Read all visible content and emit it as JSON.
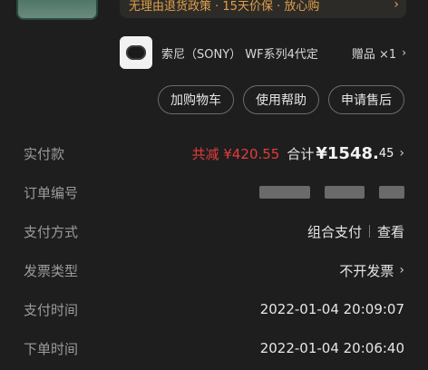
{
  "promo": {
    "text": "无理由退货政策 · 15天价保 · 放心购",
    "chevron": "›"
  },
  "gift": {
    "name": "索尼（SONY） WF系列4代定",
    "tag": "赠品 ×1",
    "chevron": "›",
    "icon": "earbuds-icon"
  },
  "actions": {
    "add_to_cart": "加购物车",
    "help": "使用帮助",
    "after_sales": "申请售后"
  },
  "order": {
    "paid_label": "实付款",
    "discount": "共减 ¥420.55",
    "total_label": "合计",
    "total_integer": "¥1548.",
    "total_decimal": "45",
    "chevron": "›",
    "order_no_label": "订单编号",
    "pay_method_label": "支付方式",
    "pay_method_value": "组合支付",
    "pay_method_link": "查看",
    "invoice_label": "发票类型",
    "invoice_value": "不开发票",
    "invoice_chevron": "›",
    "pay_time_label": "支付时间",
    "pay_time_value": "2022-01-04 20:09:07",
    "order_time_label": "下单时间",
    "order_time_value": "2022-01-04 20:06:40"
  },
  "colors": {
    "background": "#1e1e1f",
    "promo_text": "#e2a04a",
    "discount": "#e43c3c"
  }
}
